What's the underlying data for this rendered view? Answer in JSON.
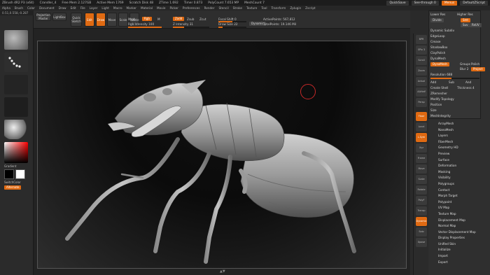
{
  "title_stats": [
    "ZBrush 4R2 P3 (x64)",
    "Crandler_4",
    "Free Mem 2.127GB",
    "Active Mem 1769",
    "Scratch Disk 48",
    "ZTime 1.692",
    "Timer 0.873",
    "PolyCount 7.653 MP",
    "MeshCount 7"
  ],
  "title_buttons": {
    "quicksave": "QuickSave",
    "seethrough": "See-through 0",
    "menus": "Menus",
    "defaultscript": "DefaultZScript"
  },
  "menu_items": [
    "Alpha",
    "Brush",
    "Color",
    "Document",
    "Draw",
    "Edit",
    "File",
    "Layer",
    "Light",
    "Macro",
    "Marker",
    "Material",
    "Movie",
    "Picker",
    "Preferences",
    "Render",
    "Stencil",
    "Stroke",
    "Texture",
    "Tool",
    "Transform",
    "Zplugin",
    "Zscript"
  ],
  "coords": "0.51,0.558,-0.287",
  "shelf": {
    "projection_master": "Projection Master",
    "lightbox": "LightBox",
    "quick_sketch": "Quick Sketch",
    "edit": "Edit",
    "draw": "Draw",
    "move": "Move",
    "scale": "Scale",
    "rotate": "Rotate",
    "mrgb": "Mrgb",
    "rgb": "Rgb",
    "m": "M",
    "rgb_intensity": "Rgb Intensity 100",
    "zadd": "Zadd",
    "zsub": "Zsub",
    "zcut": "Zcut",
    "z_intensity": "Z Intensity 31",
    "focal_shift": "Focal Shift 0",
    "draw_size": "Draw Size 22",
    "dynamic": "Dynamic",
    "active_points": "ActivePoints: 567,812",
    "total_points": "TotalPoints: 19.146 Mil"
  },
  "left_panel": {
    "gradient": "Gradient",
    "switch_color": "SwitchColor",
    "alternate": "Alternate"
  },
  "right_shelf": [
    "BPR",
    "SPix 3",
    "Scroll",
    "Zoom",
    "Actual",
    "AAHalf",
    "Persp",
    "Floor",
    "Local",
    "L.Sym",
    "Xyz",
    "Frame",
    "Move",
    "Scale",
    "Rotate",
    "PolyF",
    "Transp",
    "Dynamic",
    "Solo",
    "Xpose"
  ],
  "subtool_panel": {
    "header_left": "Lower Res",
    "header_right": "Higher Res",
    "divide": "Divide",
    "smt": "Smt",
    "suv": "Suv",
    "reuv": "ReUV",
    "items_top": [
      "Dynamic Subdiv",
      "EdgeLoop",
      "Crease",
      "ShadowBox",
      "ClayPolish",
      "DynaMesh"
    ],
    "dynamesh_btn": "DynaMesh",
    "groups": "Groups",
    "polish": "Polish",
    "blur": "Blur 2",
    "project": "Project",
    "resolution": "Resolution 688",
    "add": "Add",
    "sub": "Sub",
    "and": "And",
    "create_shell": "Create Shell",
    "thickness": "Thickness 4",
    "items_bottom": [
      "ZRemesher",
      "Modify Topology",
      "Position",
      "Size",
      "MeshIntegrity"
    ]
  },
  "tool_menu": [
    "ArrayMesh",
    "NanoMesh",
    "Layers",
    "FiberMesh",
    "Geometry HD",
    "Preview",
    "Surface",
    "Deformation",
    "Masking",
    "Visibility",
    "Polygroups",
    "Contact",
    "Morph Target",
    "Polypaint",
    "UV Map",
    "Texture Map",
    "Displacement Map",
    "Normal Map",
    "Vector Displacement Map",
    "Display Properties",
    "Unified Skin",
    "Initialize",
    "Import",
    "Export"
  ],
  "colors": {
    "accent": "#e06a12",
    "background": "#2a2a2a",
    "cursor_ring": "#c62828"
  }
}
